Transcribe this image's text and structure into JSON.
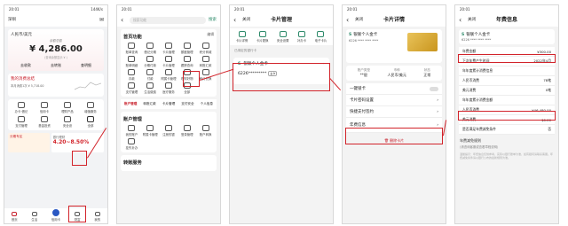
{
  "phone1": {
    "status_time": "20:01",
    "status_right": "144K/s",
    "region": "深圳",
    "currency_label": "人民币/美元",
    "balance_label": "余额总额",
    "balance": "¥ 4,286.00",
    "balance_sub": "(查询余额显示 ¥ )",
    "tabs": [
      "去收款",
      "去转账",
      "查明细"
    ],
    "promo_title": "我的消费总结",
    "promo_sub": "本月消费1次  ¥ 5,718.00",
    "icons": [
      "办卡·借记",
      "信用卡",
      "理财产品",
      "增值服务",
      "支付管理",
      "基金投资",
      "安全设",
      "全部"
    ],
    "banner_left": "分期专区",
    "banner_right_label": "银行理财",
    "banner_rate": "4.20~8.50%",
    "bottom_nav": [
      "首页",
      "生活",
      "信用卡",
      "财富",
      "我的"
    ]
  },
  "phone2": {
    "search_placeholder": "搜索功能",
    "search_btn": "搜索",
    "section_title": "首页功能",
    "edit": "编辑",
    "grid": [
      "账单查询",
      "借记分期",
      "卡片管理",
      "额度管理",
      "积分商城",
      "账单明细",
      "分期付款",
      "卡片管理",
      "跟踪查询",
      "转账汇款",
      "存款",
      "付款",
      "附属卡管理",
      "理财好物",
      "积分兑换",
      "支付管理",
      "生活缴费",
      "医疗服务",
      "全部",
      ""
    ],
    "tabs": [
      "账户管理",
      "转账汇款",
      "卡片管理",
      "支付安全",
      "个人信息"
    ],
    "section2": "账户管理",
    "grid2": [
      "我的账户",
      "附属卡管理",
      "注册的银",
      "登录管理",
      "账户转换",
      "挂失补办",
      "",
      "",
      "",
      ""
    ],
    "section3": "转账服务"
  },
  "phone3": {
    "status_time": "20:01",
    "title": "卡片管理",
    "tabs": [
      "卡片详情",
      "卡片更换",
      "安全设置",
      "补办卡",
      "电子卡片"
    ],
    "card_tip": "已绑定的银行卡",
    "card_name": "银联个人金卡",
    "card_no": "6226*********",
    "card_badge": "主卡"
  },
  "phone4": {
    "status_time": "20:01",
    "title": "卡片详情",
    "card_name": "银联个人金卡",
    "card_no": "6226 **** **** ****",
    "info_labels": [
      "账户类型",
      "币种",
      "状态"
    ],
    "info_values": [
      "**银",
      "人民币/美元",
      "正常"
    ],
    "rows": [
      "一键锁卡",
      "卡片密码设置",
      "快捷支付签约",
      "年费信息"
    ],
    "delete": "删除卡片"
  },
  "phone5": {
    "status_time": "20:01",
    "title": "年费信息",
    "card_name": "银联个人金卡",
    "card_no": "6226 **** **** ****",
    "rows": [
      {
        "label": "年费金额",
        "value": "¥300.00"
      },
      {
        "label": "下次年费产生时间",
        "value": "2022年4月"
      },
      {
        "label": "年年度累计消费信息",
        "value": ""
      },
      {
        "label": "人民币消费",
        "value": "78笔"
      },
      {
        "label": "美元消费",
        "value": "0笔"
      },
      {
        "label": "年年度累计消费金额",
        "value": ""
      },
      {
        "label": "人民币消费",
        "value": "¥46,480.00"
      },
      {
        "label": "美元消费",
        "value": "$0.00"
      },
      {
        "label": "是否满足年费减免条件",
        "value": "否"
      }
    ],
    "notes_title": "年费减免规则",
    "notes": "(请咨询客服或查看章程说明)",
    "footer": "温馨提示：年费信息仅供参考，实际以银行账单为准，如有疑问请联系客服。年费减免条件请以银行公布的最新规则为准。"
  },
  "colors": {
    "accent": "#c8202c",
    "highlight_box": "#d2232a",
    "green": "#2d8a6a"
  }
}
